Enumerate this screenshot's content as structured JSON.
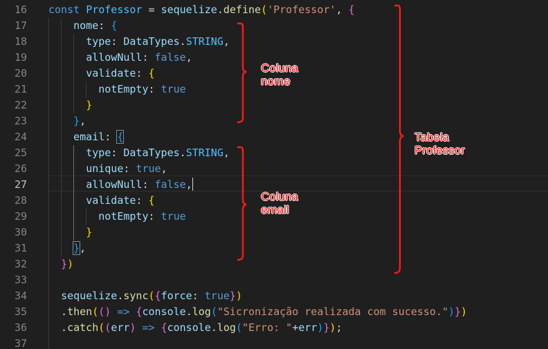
{
  "editor": {
    "active_line": "27",
    "lines": [
      {
        "num": "16",
        "tokens": [
          {
            "t": "const",
            "c": "kw"
          },
          {
            "t": " "
          },
          {
            "t": "Professor",
            "c": "var"
          },
          {
            "t": " = "
          },
          {
            "t": "sequelize",
            "c": "prop"
          },
          {
            "t": "."
          },
          {
            "t": "define",
            "c": "fn"
          },
          {
            "t": "(",
            "c": "p1"
          },
          {
            "t": "'Professor'",
            "c": "str"
          },
          {
            "t": ", "
          },
          {
            "t": "{",
            "c": "p2"
          }
        ]
      },
      {
        "num": "17",
        "tokens": [
          {
            "t": "    "
          },
          {
            "t": "nome",
            "c": "prop"
          },
          {
            "t": ": "
          },
          {
            "t": "{",
            "c": "p3"
          }
        ]
      },
      {
        "num": "18",
        "tokens": [
          {
            "t": "      "
          },
          {
            "t": "type",
            "c": "prop"
          },
          {
            "t": ": "
          },
          {
            "t": "DataTypes",
            "c": "prop"
          },
          {
            "t": "."
          },
          {
            "t": "STRING",
            "c": "var"
          },
          {
            "t": ","
          }
        ]
      },
      {
        "num": "19",
        "tokens": [
          {
            "t": "      "
          },
          {
            "t": "allowNull",
            "c": "prop"
          },
          {
            "t": ": "
          },
          {
            "t": "false",
            "c": "kw"
          },
          {
            "t": ","
          }
        ]
      },
      {
        "num": "20",
        "tokens": [
          {
            "t": "      "
          },
          {
            "t": "validate",
            "c": "prop"
          },
          {
            "t": ": "
          },
          {
            "t": "{",
            "c": "p1"
          }
        ]
      },
      {
        "num": "21",
        "tokens": [
          {
            "t": "        "
          },
          {
            "t": "notEmpty",
            "c": "prop"
          },
          {
            "t": ": "
          },
          {
            "t": "true",
            "c": "kw"
          }
        ]
      },
      {
        "num": "22",
        "tokens": [
          {
            "t": "      "
          },
          {
            "t": "}",
            "c": "p1"
          }
        ]
      },
      {
        "num": "23",
        "tokens": [
          {
            "t": "    "
          },
          {
            "t": "}",
            "c": "p3"
          },
          {
            "t": ","
          }
        ]
      },
      {
        "num": "24",
        "tokens": [
          {
            "t": "    "
          },
          {
            "t": "email",
            "c": "prop"
          },
          {
            "t": ": "
          },
          {
            "t": "{",
            "c": "p3 bmatch"
          }
        ]
      },
      {
        "num": "25",
        "tokens": [
          {
            "t": "      "
          },
          {
            "t": "type",
            "c": "prop"
          },
          {
            "t": ": "
          },
          {
            "t": "DataTypes",
            "c": "prop"
          },
          {
            "t": "."
          },
          {
            "t": "STRING",
            "c": "var"
          },
          {
            "t": ","
          }
        ]
      },
      {
        "num": "26",
        "tokens": [
          {
            "t": "      "
          },
          {
            "t": "unique",
            "c": "prop"
          },
          {
            "t": ": "
          },
          {
            "t": "true",
            "c": "kw"
          },
          {
            "t": ","
          }
        ]
      },
      {
        "num": "27",
        "tokens": [
          {
            "t": "      "
          },
          {
            "t": "allowNull",
            "c": "prop"
          },
          {
            "t": ": "
          },
          {
            "t": "false",
            "c": "kw"
          },
          {
            "t": ","
          },
          {
            "t": "",
            "c": "caret"
          }
        ]
      },
      {
        "num": "28",
        "tokens": [
          {
            "t": "      "
          },
          {
            "t": "validate",
            "c": "prop"
          },
          {
            "t": ": "
          },
          {
            "t": "{",
            "c": "p1"
          }
        ]
      },
      {
        "num": "29",
        "tokens": [
          {
            "t": "        "
          },
          {
            "t": "notEmpty",
            "c": "prop"
          },
          {
            "t": ": "
          },
          {
            "t": "true",
            "c": "kw"
          }
        ]
      },
      {
        "num": "30",
        "tokens": [
          {
            "t": "      "
          },
          {
            "t": "}",
            "c": "p1"
          }
        ]
      },
      {
        "num": "31",
        "tokens": [
          {
            "t": "    "
          },
          {
            "t": "}",
            "c": "p3 bmatch"
          },
          {
            "t": ","
          }
        ]
      },
      {
        "num": "32",
        "tokens": [
          {
            "t": "  "
          },
          {
            "t": "}",
            "c": "p2"
          },
          {
            "t": ")",
            "c": "p1"
          }
        ]
      },
      {
        "num": "33",
        "tokens": []
      },
      {
        "num": "34",
        "tokens": [
          {
            "t": "  "
          },
          {
            "t": "sequelize",
            "c": "prop"
          },
          {
            "t": "."
          },
          {
            "t": "sync",
            "c": "fn"
          },
          {
            "t": "(",
            "c": "p1"
          },
          {
            "t": "{",
            "c": "p2"
          },
          {
            "t": "force",
            "c": "prop"
          },
          {
            "t": ": "
          },
          {
            "t": "true",
            "c": "kw"
          },
          {
            "t": "}",
            "c": "p2"
          },
          {
            "t": ")",
            "c": "p1"
          }
        ]
      },
      {
        "num": "35",
        "tokens": [
          {
            "t": "  ."
          },
          {
            "t": "then",
            "c": "fn"
          },
          {
            "t": "(",
            "c": "p1"
          },
          {
            "t": "()",
            "c": "p2"
          },
          {
            "t": " "
          },
          {
            "t": "=>",
            "c": "kw"
          },
          {
            "t": " "
          },
          {
            "t": "{",
            "c": "p2"
          },
          {
            "t": "console",
            "c": "prop"
          },
          {
            "t": "."
          },
          {
            "t": "log",
            "c": "fn"
          },
          {
            "t": "(",
            "c": "p3"
          },
          {
            "t": "\"Sicronização realizada com sucesso.\"",
            "c": "str"
          },
          {
            "t": ")",
            "c": "p3"
          },
          {
            "t": "}",
            "c": "p2"
          },
          {
            "t": ")",
            "c": "p1"
          }
        ]
      },
      {
        "num": "36",
        "tokens": [
          {
            "t": "  ."
          },
          {
            "t": "catch",
            "c": "fn"
          },
          {
            "t": "(",
            "c": "p1"
          },
          {
            "t": "(",
            "c": "p2"
          },
          {
            "t": "err",
            "c": "prop"
          },
          {
            "t": ")",
            "c": "p2"
          },
          {
            "t": " "
          },
          {
            "t": "=>",
            "c": "kw"
          },
          {
            "t": " "
          },
          {
            "t": "{",
            "c": "p2"
          },
          {
            "t": "console",
            "c": "prop"
          },
          {
            "t": "."
          },
          {
            "t": "log",
            "c": "fn"
          },
          {
            "t": "(",
            "c": "p3"
          },
          {
            "t": "\"Erro: \"",
            "c": "str"
          },
          {
            "t": "+"
          },
          {
            "t": "err",
            "c": "prop"
          },
          {
            "t": ")",
            "c": "p3"
          },
          {
            "t": "}",
            "c": "p2"
          },
          {
            "t": ")",
            "c": "p1"
          },
          {
            "t": ";"
          }
        ]
      },
      {
        "num": "37",
        "tokens": []
      }
    ]
  },
  "annotations": {
    "color": "#ff1a1a",
    "coluna_nome": {
      "line1": "Coluna",
      "line2": "nome"
    },
    "coluna_email": {
      "line1": "Coluna",
      "line2": "email"
    },
    "tabela": {
      "line1": "Tabela",
      "line2": "Professor"
    }
  }
}
